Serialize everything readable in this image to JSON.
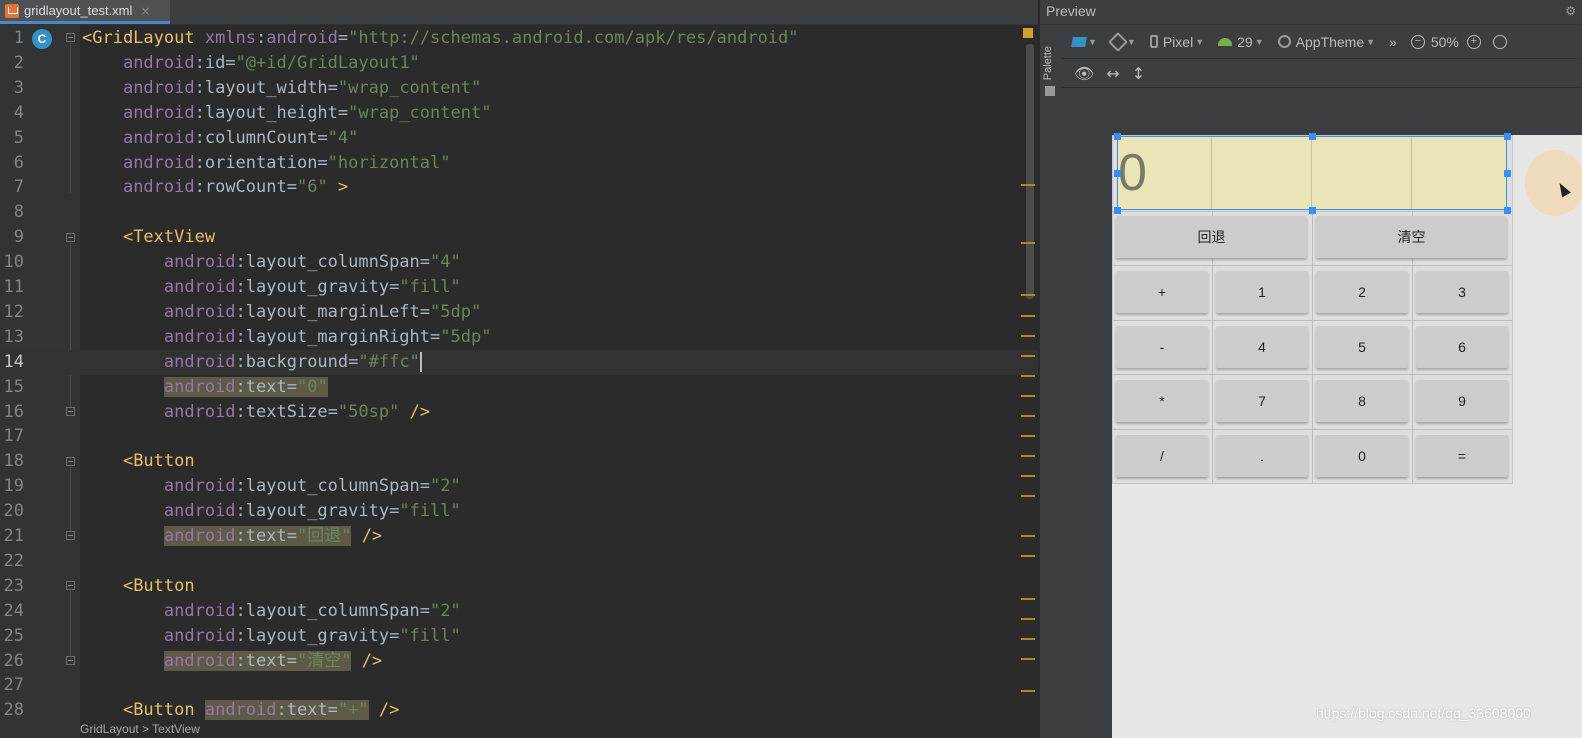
{
  "editor": {
    "tab": {
      "label": "gridlayout_test.xml",
      "close": "×"
    },
    "class_badge": "C",
    "breadcrumb": "GridLayout > TextView",
    "lines": [
      [
        {
          "c": "tag",
          "t": "<GridLayout "
        },
        {
          "c": "attr",
          "t": "xmlns"
        },
        {
          "c": "plain",
          "t": ":"
        },
        {
          "c": "attr",
          "t": "android"
        },
        {
          "c": "plain",
          "t": "="
        },
        {
          "c": "val",
          "t": "\"http://schemas.android.com/apk/res/android\""
        }
      ],
      [
        {
          "c": "plain",
          "t": "    "
        },
        {
          "c": "attr",
          "t": "android"
        },
        {
          "c": "plain",
          "t": ":id="
        },
        {
          "c": "val",
          "t": "\"@+id/GridLayout1\""
        }
      ],
      [
        {
          "c": "plain",
          "t": "    "
        },
        {
          "c": "attr",
          "t": "android"
        },
        {
          "c": "plain",
          "t": ":layout_width="
        },
        {
          "c": "val",
          "t": "\"wrap_content\""
        }
      ],
      [
        {
          "c": "plain",
          "t": "    "
        },
        {
          "c": "attr",
          "t": "android"
        },
        {
          "c": "plain",
          "t": ":layout_height="
        },
        {
          "c": "val",
          "t": "\"wrap_content\""
        }
      ],
      [
        {
          "c": "plain",
          "t": "    "
        },
        {
          "c": "attr",
          "t": "android"
        },
        {
          "c": "plain",
          "t": ":columnCount="
        },
        {
          "c": "val",
          "t": "\"4\""
        }
      ],
      [
        {
          "c": "plain",
          "t": "    "
        },
        {
          "c": "attr",
          "t": "android"
        },
        {
          "c": "plain",
          "t": ":orientation="
        },
        {
          "c": "val",
          "t": "\"horizontal\""
        }
      ],
      [
        {
          "c": "plain",
          "t": "    "
        },
        {
          "c": "attr",
          "t": "android"
        },
        {
          "c": "plain",
          "t": ":rowCount="
        },
        {
          "c": "val",
          "t": "\"6\""
        },
        {
          "c": "tag",
          "t": " >"
        }
      ],
      [],
      [
        {
          "c": "plain",
          "t": "    "
        },
        {
          "c": "tag",
          "t": "<TextView"
        }
      ],
      [
        {
          "c": "plain",
          "t": "        "
        },
        {
          "c": "attr",
          "t": "android"
        },
        {
          "c": "plain",
          "t": ":layout_columnSpan="
        },
        {
          "c": "val",
          "t": "\"4\""
        }
      ],
      [
        {
          "c": "plain",
          "t": "        "
        },
        {
          "c": "attr",
          "t": "android"
        },
        {
          "c": "plain",
          "t": ":layout_gravity="
        },
        {
          "c": "val",
          "t": "\"fill\""
        }
      ],
      [
        {
          "c": "plain",
          "t": "        "
        },
        {
          "c": "attr",
          "t": "android"
        },
        {
          "c": "plain",
          "t": ":layout_marginLeft="
        },
        {
          "c": "val",
          "t": "\"5dp\""
        }
      ],
      [
        {
          "c": "plain",
          "t": "        "
        },
        {
          "c": "attr",
          "t": "android"
        },
        {
          "c": "plain",
          "t": ":layout_marginRight="
        },
        {
          "c": "val",
          "t": "\"5dp\""
        }
      ],
      [
        {
          "c": "plain",
          "t": "        "
        },
        {
          "c": "attr",
          "t": "android"
        },
        {
          "c": "plain",
          "t": ":background="
        },
        {
          "c": "val",
          "t": "\"#ffc\""
        }
      ],
      [
        {
          "c": "plain",
          "t": "        "
        },
        {
          "c": "attr hl",
          "t": "android"
        },
        {
          "c": "plain hl",
          "t": ":text="
        },
        {
          "c": "val hl",
          "t": "\"0\""
        }
      ],
      [
        {
          "c": "plain",
          "t": "        "
        },
        {
          "c": "attr",
          "t": "android"
        },
        {
          "c": "plain",
          "t": ":textSize="
        },
        {
          "c": "val",
          "t": "\"50sp\""
        },
        {
          "c": "tag",
          "t": " />"
        }
      ],
      [],
      [
        {
          "c": "plain",
          "t": "    "
        },
        {
          "c": "tag",
          "t": "<Button"
        }
      ],
      [
        {
          "c": "plain",
          "t": "        "
        },
        {
          "c": "attr",
          "t": "android"
        },
        {
          "c": "plain",
          "t": ":layout_columnSpan="
        },
        {
          "c": "val",
          "t": "\"2\""
        }
      ],
      [
        {
          "c": "plain",
          "t": "        "
        },
        {
          "c": "attr",
          "t": "android"
        },
        {
          "c": "plain",
          "t": ":layout_gravity="
        },
        {
          "c": "val",
          "t": "\"fill\""
        }
      ],
      [
        {
          "c": "plain",
          "t": "        "
        },
        {
          "c": "attr hl",
          "t": "android"
        },
        {
          "c": "plain hl",
          "t": ":text="
        },
        {
          "c": "val hl",
          "t": "\"回退\""
        },
        {
          "c": "tag",
          "t": " />"
        }
      ],
      [],
      [
        {
          "c": "plain",
          "t": "    "
        },
        {
          "c": "tag",
          "t": "<Button"
        }
      ],
      [
        {
          "c": "plain",
          "t": "        "
        },
        {
          "c": "attr",
          "t": "android"
        },
        {
          "c": "plain",
          "t": ":layout_columnSpan="
        },
        {
          "c": "val",
          "t": "\"2\""
        }
      ],
      [
        {
          "c": "plain",
          "t": "        "
        },
        {
          "c": "attr",
          "t": "android"
        },
        {
          "c": "plain",
          "t": ":layout_gravity="
        },
        {
          "c": "val",
          "t": "\"fill\""
        }
      ],
      [
        {
          "c": "plain",
          "t": "        "
        },
        {
          "c": "attr hl",
          "t": "android"
        },
        {
          "c": "plain hl",
          "t": ":text="
        },
        {
          "c": "val hl",
          "t": "\"清空\""
        },
        {
          "c": "tag",
          "t": " />"
        }
      ],
      [],
      [
        {
          "c": "plain",
          "t": "    "
        },
        {
          "c": "tag",
          "t": "<Button "
        },
        {
          "c": "attr hl",
          "t": "android"
        },
        {
          "c": "plain hl",
          "t": ":text="
        },
        {
          "c": "val hl",
          "t": "\"+\""
        },
        {
          "c": "tag",
          "t": " />"
        }
      ]
    ],
    "current_line": 14
  },
  "preview": {
    "title": "Preview",
    "palette_label": "Palette",
    "toolbar": {
      "device": "Pixel",
      "api": "29",
      "theme": "AppTheme",
      "more": "»",
      "zoom": "50%",
      "zoom_out": "−",
      "zoom_in": "+"
    },
    "toolbar2": {
      "eye": "👁",
      "horizontal": "↔",
      "vertical": "↕"
    },
    "display_text": "0",
    "buttons": [
      {
        "label": "回退"
      },
      {
        "label": "清空"
      },
      {
        "label": "+"
      },
      {
        "label": "1"
      },
      {
        "label": "2"
      },
      {
        "label": "3"
      },
      {
        "label": "-"
      },
      {
        "label": "4"
      },
      {
        "label": "5"
      },
      {
        "label": "6"
      },
      {
        "label": "*"
      },
      {
        "label": "7"
      },
      {
        "label": "8"
      },
      {
        "label": "9"
      },
      {
        "label": "/"
      },
      {
        "label": "."
      },
      {
        "label": "0"
      },
      {
        "label": "="
      }
    ]
  },
  "watermark": "https://blog.csdn.net/qq_33608000",
  "colors": {
    "tv_background": "#eae5b6",
    "selection_blue": "#3c8ef5",
    "accent": "#3592c4"
  }
}
